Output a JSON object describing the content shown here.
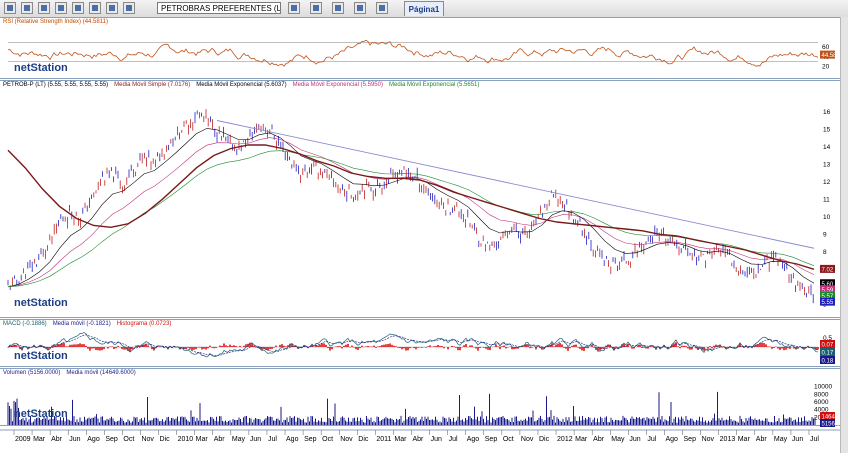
{
  "toolbar": {
    "symbol_value": "PETROBRAS PREFERENTES (LATIBEX)",
    "page_tab": "Página1",
    "icons": [
      "new-icon",
      "open-icon",
      "save-icon",
      "print-icon",
      "cut-icon",
      "copy-icon",
      "paste-icon",
      "undo-icon",
      "zoom-icon",
      "chart-icon",
      "indicator-icon",
      "drawing-icon",
      "settings-icon"
    ]
  },
  "watermark": "netStation",
  "panels": {
    "rsi": {
      "title": "RSI (Relative Strength Index) (44.5811)",
      "ticks": [
        "60",
        "40",
        "20"
      ],
      "last_tag": "44.58"
    },
    "price": {
      "legend": [
        {
          "text": "PETROB-P (LT) (5.55, 5.55, 5.55, 5.55)",
          "color": "#000000"
        },
        {
          "text": "Media Móvil Simple (7.0176)",
          "color": "#8b1a1a"
        },
        {
          "text": "Media Móvil Exponencial (5.6037)",
          "color": "#000000"
        },
        {
          "text": "Media Móvil Exponencial (5.5950)",
          "color": "#c0307a"
        },
        {
          "text": "Media Móvil Exponencial (5.5651)",
          "color": "#1e8a2e"
        }
      ],
      "ticks": [
        "16",
        "15",
        "14",
        "13",
        "12",
        "11",
        "10",
        "9",
        "8",
        "7",
        "6",
        "5"
      ],
      "tags": [
        {
          "label": "7.02",
          "color": "#8b1a1a"
        },
        {
          "label": "5.60",
          "color": "#000000"
        },
        {
          "label": "5.59",
          "color": "#c0307a"
        },
        {
          "label": "5.57",
          "color": "#1e8a2e"
        },
        {
          "label": "5.55",
          "color": "#2020c0"
        }
      ]
    },
    "macd": {
      "legend": [
        {
          "text": "MACD (-0.1886)",
          "color": "#1a6070"
        },
        {
          "text": "Media móvil (-0.1821)",
          "color": "#1a1a8a"
        },
        {
          "text": "Histograma (0.0723)",
          "color": "#d01010"
        }
      ],
      "ticks": [
        "0.5",
        "0.0"
      ],
      "tags": [
        {
          "label": "0.07",
          "color": "#d01010"
        },
        {
          "label": "0.17",
          "color": "#1a6070"
        },
        {
          "label": "0.18",
          "color": "#1a1a8a"
        }
      ]
    },
    "volume": {
      "legend": [
        {
          "text": "Volumen (5156.0000)",
          "color": "#1a1a8a"
        },
        {
          "text": "Media móvil (14649.6000)",
          "color": "#1a1a8a"
        }
      ],
      "ticks": [
        "10000",
        "8000",
        "6000",
        "4000",
        "2000"
      ],
      "tags": [
        {
          "label": "14649.60",
          "color": "#d01010"
        },
        {
          "label": "5156.00",
          "color": "#1a1a8a"
        }
      ]
    }
  },
  "x_axis_labels": [
    "2009",
    "Mar",
    "Abr",
    "Jun",
    "Ago",
    "Sep",
    "Oct",
    "Nov",
    "Dic",
    "2010",
    "Mar",
    "Abr",
    "May",
    "Jun",
    "Jul",
    "Ago",
    "Sep",
    "Oct",
    "Nov",
    "Dic",
    "2011",
    "Mar",
    "Abr",
    "Jun",
    "Jul",
    "Ago",
    "Sep",
    "Oct",
    "Nov",
    "Dic",
    "2012",
    "Mar",
    "Abr",
    "May",
    "Jun",
    "Jul",
    "Ago",
    "Sep",
    "Nov",
    "2013",
    "Mar",
    "Abr",
    "May",
    "Jun",
    "Jul"
  ],
  "chart_data": {
    "type": "line",
    "title": "PETROBRAS PREFERENTES (LATIBEX)",
    "x_range": [
      "2009-01",
      "2013-07"
    ],
    "price": {
      "ylim": [
        4.5,
        16.5
      ],
      "close": [
        6.0,
        6.4,
        7.0,
        7.6,
        8.5,
        9.8,
        10.2,
        10.0,
        11.0,
        12.2,
        12.4,
        11.8,
        12.8,
        13.4,
        13.0,
        14.0,
        14.6,
        15.2,
        15.8,
        15.6,
        14.8,
        14.2,
        13.9,
        14.4,
        15.2,
        15.0,
        14.0,
        13.2,
        12.4,
        12.8,
        12.6,
        12.0,
        11.5,
        11.2,
        11.8,
        11.6,
        11.9,
        12.4,
        12.6,
        12.2,
        11.5,
        10.8,
        10.6,
        10.4,
        9.8,
        8.8,
        8.2,
        8.6,
        9.4,
        9.0,
        9.2,
        10.2,
        11.2,
        10.8,
        10.0,
        9.2,
        8.2,
        7.4,
        7.2,
        7.5,
        8.0,
        8.6,
        8.9,
        8.7,
        8.4,
        8.0,
        7.6,
        7.8,
        8.2,
        7.6,
        7.0,
        6.8,
        7.2,
        7.8,
        7.4,
        6.4,
        5.6,
        5.55
      ],
      "sma_200": [
        13.8,
        12.8,
        11.6,
        10.6,
        9.9,
        9.5,
        9.4,
        9.6,
        10.2,
        11.0,
        11.9,
        12.8,
        13.5,
        13.9,
        14.1,
        14.1,
        13.9,
        13.6,
        13.2,
        12.9,
        12.5,
        12.3,
        12.2,
        12.2,
        12.1,
        11.8,
        11.4,
        11.1,
        10.8,
        10.5,
        10.2,
        9.9,
        9.7,
        9.6,
        9.5,
        9.4,
        9.3,
        9.2,
        9.0,
        8.9,
        8.7,
        8.5,
        8.3,
        8.1,
        7.8,
        7.5,
        7.3,
        7.0
      ],
      "trendline": [
        {
          "x": "2010-03",
          "y": 15.5
        },
        {
          "x": "2013-07",
          "y": 8.2
        }
      ]
    },
    "rsi": {
      "ylim": [
        0,
        100
      ],
      "levels": [
        30,
        70
      ],
      "last": 44.5811
    },
    "macd": {
      "last_macd": -0.1886,
      "last_signal": -0.1821,
      "last_hist": 0.0723
    },
    "volume": {
      "ylim": [
        0,
        12000
      ],
      "last": 5156,
      "ma": 14649.6
    }
  }
}
